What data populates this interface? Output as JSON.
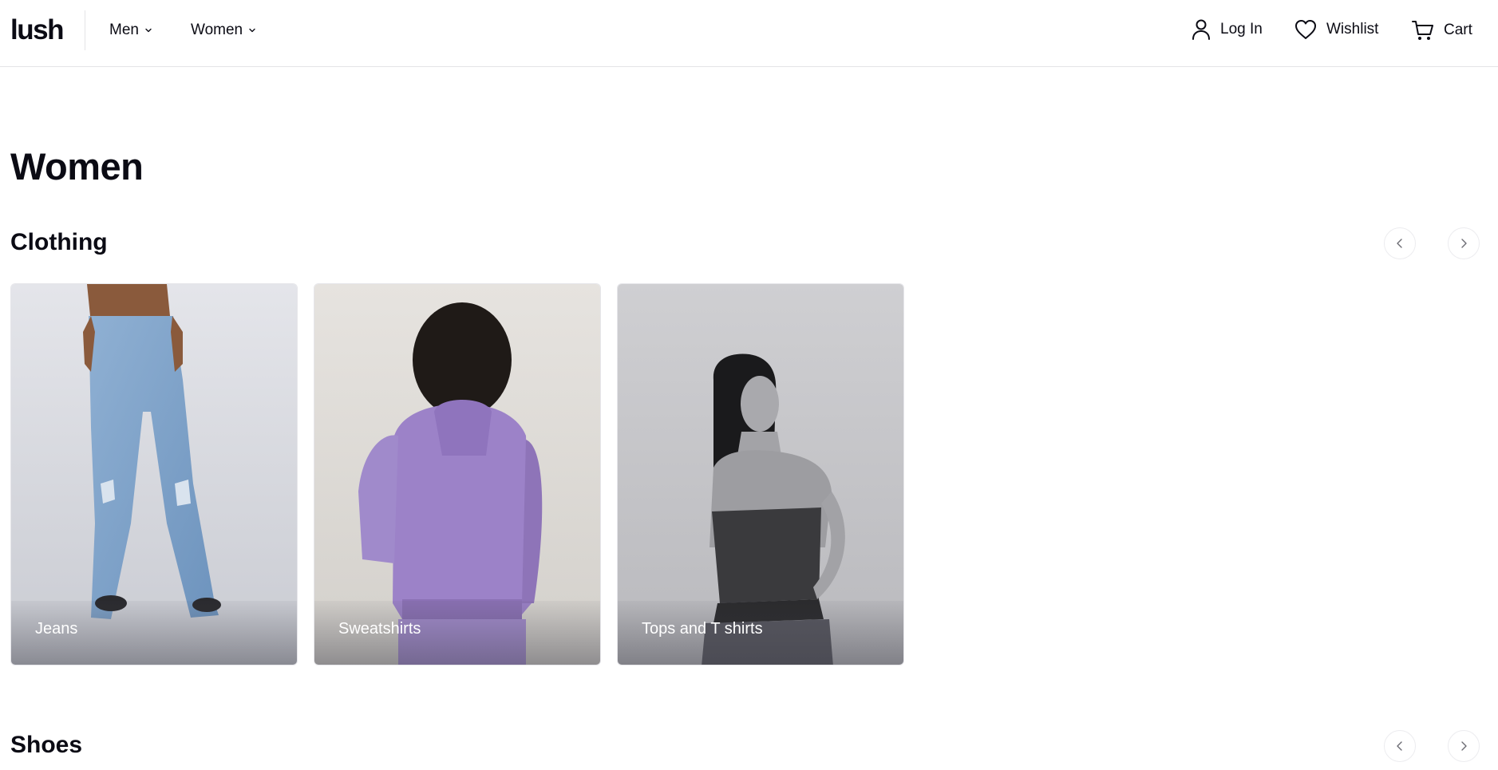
{
  "header": {
    "logo": "lush",
    "nav": [
      {
        "label": "Men",
        "icon": "chevron-down-icon"
      },
      {
        "label": "Women",
        "icon": "chevron-down-icon"
      }
    ],
    "actions": {
      "login": {
        "label": "Log In",
        "icon": "user-icon"
      },
      "wishlist": {
        "label": "Wishlist",
        "icon": "heart-icon"
      },
      "cart": {
        "label": "Cart",
        "icon": "cart-icon"
      }
    }
  },
  "page": {
    "title": "Women"
  },
  "sections": [
    {
      "title": "Clothing",
      "prev_icon": "chevron-left-icon",
      "next_icon": "chevron-right-icon",
      "cards": [
        {
          "label": "Jeans"
        },
        {
          "label": "Sweatshirts"
        },
        {
          "label": "Tops and T shirts"
        }
      ]
    },
    {
      "title": "Shoes",
      "prev_icon": "chevron-left-icon",
      "next_icon": "chevron-right-icon"
    }
  ],
  "colors": {
    "text": "#0b0b14",
    "border": "#e4e4e7",
    "jeans_blue": "#7fa3c9",
    "hoodie_purple": "#9a7dc4",
    "bw_photo": "#8a8a8e"
  }
}
